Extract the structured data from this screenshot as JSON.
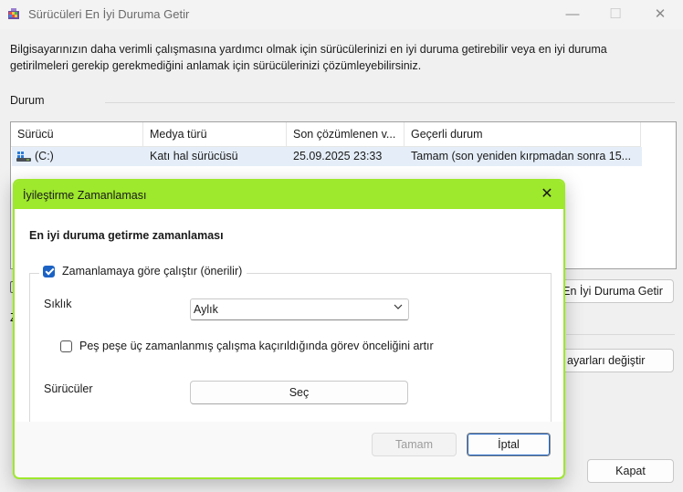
{
  "window": {
    "title": "Sürücüleri En İyi Duruma Getir",
    "controls": {
      "minimize": "—",
      "maximize": "☐",
      "close": "✕"
    }
  },
  "description": "Bilgisayarınızın daha verimli çalışmasına yardımcı olmak için sürücülerinizi en iyi duruma getirebilir veya en iyi duruma getirilmeleri gerekip gerekmediğini anlamak için sürücülerinizi çözümleyebilirsiniz.",
  "status_section": {
    "label": "Durum"
  },
  "drive_list": {
    "columns": [
      "Sürücü",
      "Medya türü",
      "Son çözümlenen v...",
      "Geçerli durum"
    ],
    "rows": [
      {
        "drive": "(C:)",
        "media_type": "Katı hal sürücüsü",
        "last_analyzed": "25.09.2025 23:33",
        "status": "Tamam (son yeniden kırpmadan sonra 15..."
      }
    ]
  },
  "main_buttons": {
    "optimize": "En İyi Duruma Getir",
    "change_settings": "ayarları değiştir",
    "close": "Kapat"
  },
  "dialog": {
    "title": "İyileştirme Zamanlaması",
    "close_glyph": "✕",
    "heading": "En iyi duruma getirme zamanlaması",
    "run_on_schedule": {
      "label": "Zamanlamaya göre çalıştır (önerilir)",
      "checked": true
    },
    "frequency": {
      "label": "Sıklık",
      "value": "Aylık"
    },
    "increase_priority": {
      "label": "Peş peşe üç zamanlanmış çalışma kaçırıldığında görev önceliğini artır",
      "checked": false
    },
    "drives": {
      "label": "Sürücüler",
      "button": "Seç"
    },
    "ok_button": "Tamam",
    "cancel_button": "İptal"
  },
  "colors": {
    "accent": "#9ee82d",
    "selection": "#e5eef8",
    "checkbox": "#1b62c4"
  }
}
